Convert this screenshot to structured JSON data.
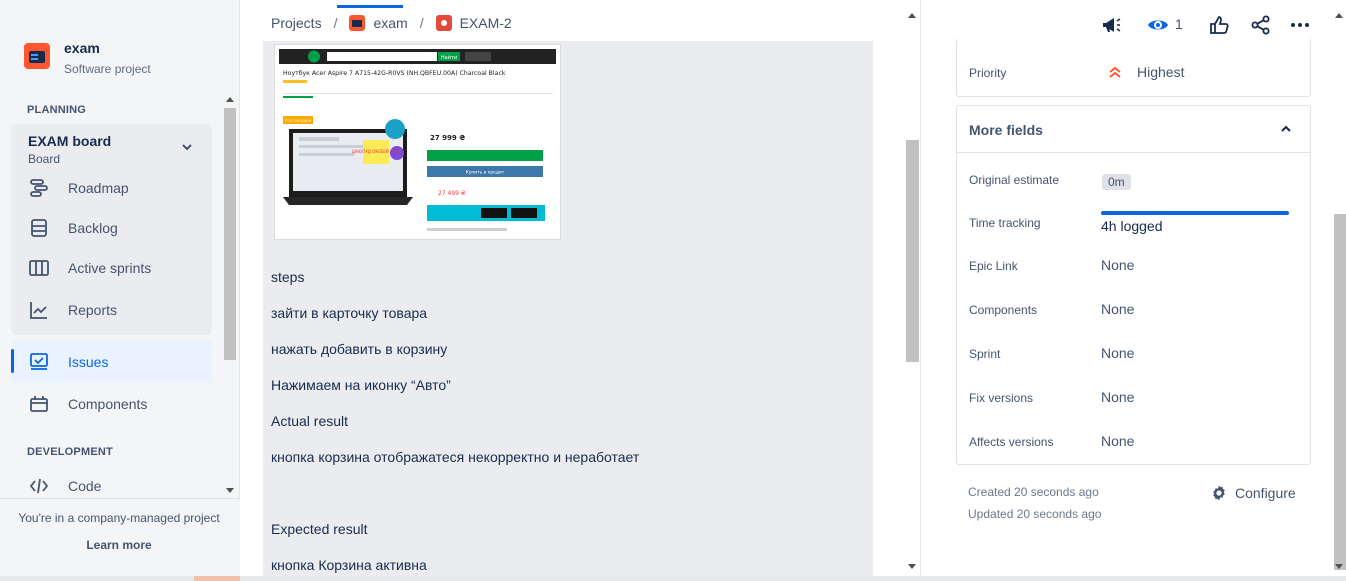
{
  "project": {
    "name": "exam",
    "type": "Software project"
  },
  "sidebar": {
    "planning_title": "PLANNING",
    "board": {
      "title": "EXAM board",
      "subtitle": "Board"
    },
    "board_items": [
      {
        "label": "Roadmap",
        "icon": "roadmap-icon"
      },
      {
        "label": "Backlog",
        "icon": "backlog-icon"
      },
      {
        "label": "Active sprints",
        "icon": "columns-icon"
      },
      {
        "label": "Reports",
        "icon": "chart-line-icon"
      }
    ],
    "items": [
      {
        "label": "Issues",
        "icon": "issues-icon",
        "active": true
      },
      {
        "label": "Components",
        "icon": "components-icon",
        "active": false
      }
    ],
    "development_title": "DEVELOPMENT",
    "dev_items": [
      {
        "label": "Code",
        "icon": "code-icon"
      }
    ],
    "footer_text": "You're in a company-managed project",
    "footer_link": "Learn more"
  },
  "breadcrumb": {
    "root": "Projects",
    "project": "exam",
    "issue": "EXAM-2"
  },
  "description": {
    "lines": [
      "steps",
      "зайти в карточку товара",
      "нажать добавить в корзину",
      "Нажимаем на иконку “Авто”",
      "Actual result",
      "кнопка корзина отображатеся некорректно и неработает",
      "Expected result",
      "кнопка Корзина активна"
    ],
    "screenshot": {
      "product_title": "Ноутбук Acer Aspire 7 A715-42G-R0VS (NH.QBFEU.00A) Charcoal Black",
      "price_main": "27 999 ₴",
      "price_alt": "27 499 ₴",
      "badge": "ЦІНОПАД ОКЕЕЕЙ -55%",
      "buy_button": "Купить в кредит",
      "search_button": "Найти",
      "top_label": "ТОП ПРОДАЖ"
    }
  },
  "header_actions": {
    "watchers_count": "1"
  },
  "fields": {
    "priority_label": "Priority",
    "priority_value": "Highest",
    "more_fields_title": "More fields",
    "rows": [
      {
        "label": "Original estimate",
        "value": "0m"
      },
      {
        "label": "Time tracking",
        "value": "4h logged"
      },
      {
        "label": "Epic Link",
        "value": "None"
      },
      {
        "label": "Components",
        "value": "None"
      },
      {
        "label": "Sprint",
        "value": "None"
      },
      {
        "label": "Fix versions",
        "value": "None"
      },
      {
        "label": "Affects versions",
        "value": "None"
      }
    ]
  },
  "meta": {
    "created": "Created 20 seconds ago",
    "updated": "Updated 20 seconds ago",
    "configure": "Configure"
  },
  "colors": {
    "accent": "#0c66e4",
    "priority": "#ff5630",
    "brand": "#ff5630"
  }
}
